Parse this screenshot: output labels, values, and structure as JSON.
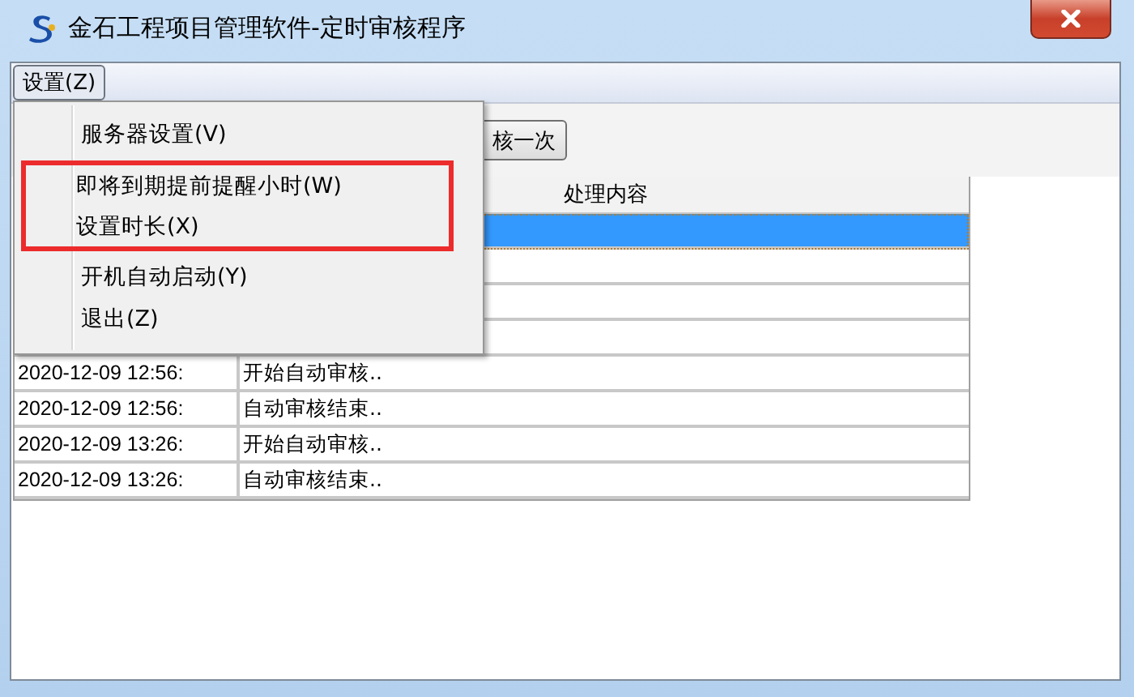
{
  "window": {
    "title": "金石工程项目管理软件-定时审核程序"
  },
  "menu_bar": [
    {
      "label": "设置(Z)",
      "selected": true
    }
  ],
  "open_menu": {
    "items": [
      {
        "label": "服务器设置(V)",
        "marked": false
      },
      {
        "label": "即将到期提前提醒小时(W)",
        "marked": true
      },
      {
        "label": "设置时长(X)",
        "marked": true
      },
      {
        "label": "开机自动启动(Y)",
        "marked": false
      },
      {
        "label": "退出(Z)",
        "marked": false
      }
    ]
  },
  "toolbar": {
    "buttons": [
      {
        "label": "核一次"
      }
    ]
  },
  "table": {
    "header": {
      "column_2": "处理内容"
    },
    "rows": [
      {
        "selected": true
      },
      {
        "selected": false
      },
      {
        "selected": false
      },
      {
        "selected": false
      },
      {
        "selected": false,
        "time": "2020-12-09 12:56:",
        "message": "开始自动审核.."
      },
      {
        "selected": false,
        "time": "2020-12-09 12:56:",
        "message": "自动审核结束.."
      },
      {
        "selected": false,
        "time": "2020-12-09 13:26:",
        "message": "开始自动审核.."
      },
      {
        "selected": false,
        "time": "2020-12-09 13:26:",
        "message": "自动审核结束.."
      }
    ]
  }
}
